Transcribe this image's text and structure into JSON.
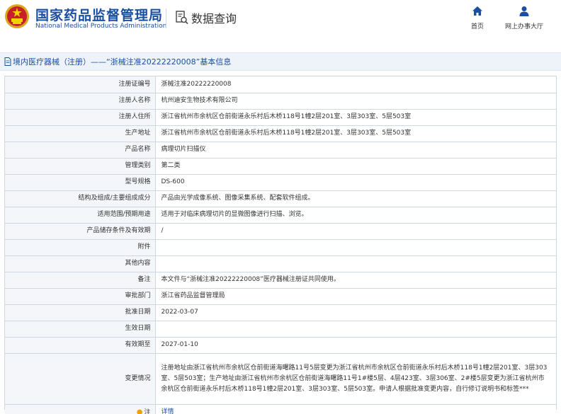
{
  "header": {
    "brand_cn": "国家药品监督管理局",
    "brand_en": "National Medical Products Administration",
    "query_label": "数据查询",
    "nav_home": "首页",
    "nav_service": "网上办事大厅"
  },
  "title": "境内医疗器械（注册）——“浙械注准20222220008”基本信息",
  "rows": [
    {
      "label": "注册证编号",
      "value": "浙械注准20222220008"
    },
    {
      "label": "注册人名称",
      "value": "杭州迪安生物技术有限公司"
    },
    {
      "label": "注册人住所",
      "value": "浙江省杭州市余杭区仓前街道永乐村后木桥118号1幢2层201室、3层303室、5层503室"
    },
    {
      "label": "生产地址",
      "value": "浙江省杭州市余杭区仓前街道永乐村后木桥118号1幢2层201室、3层303室、5层503室"
    },
    {
      "label": "产品名称",
      "value": "病理切片扫描仪"
    },
    {
      "label": "管理类别",
      "value": "第二类"
    },
    {
      "label": "型号规格",
      "value": "DS-600"
    },
    {
      "label": "结构及组成/主要组成成分",
      "value": "产品由光学成像系统、图像采集系统、配套软件组成。"
    },
    {
      "label": "适用范围/预期用途",
      "value": "适用于对临床病理切片的显微图像进行扫描、浏览。"
    },
    {
      "label": "产品储存条件及有效期",
      "value": "/"
    },
    {
      "label": "附件",
      "value": ""
    },
    {
      "label": "其他内容",
      "value": ""
    },
    {
      "label": "备注",
      "value": "本文件与“浙械注准20222220008”医疗器械注册证共同使用。"
    },
    {
      "label": "审批部门",
      "value": "浙江省药品监督管理局"
    },
    {
      "label": "批准日期",
      "value": "2022-03-07"
    },
    {
      "label": "生效日期",
      "value": ""
    },
    {
      "label": "有效期至",
      "value": "2027-01-10"
    },
    {
      "label": "变更情况",
      "value": "注册地址由浙江省杭州市余杭区仓前街道海曙路11号5层变更为浙江省杭州市余杭区仓前街道永乐村后木桥118号1幢2层201室、3层303室、5层503室；生产地址由浙江省杭州市余杭区仓前街道海曙路11号1#楼5层、4层423室、3层306室、2#楼5层变更为浙江省杭州市余杭区仓前街道永乐村后木桥118号1幢2层201室、3层303室、5层503室。申请人根据批准变更内容，自行修订说明书和标签***"
    }
  ],
  "note": {
    "label": "注",
    "link": "详情"
  },
  "colors": {
    "brand": "#1b4fa0",
    "label_bg": "#f4f6f9",
    "border": "#cfd7e2",
    "star": "#f0a000"
  },
  "icons": {
    "logo": "emblem-icon",
    "query": "search-document-icon",
    "home": "home-icon",
    "service": "user-icon",
    "title": "document-icon",
    "note": "star-icon"
  }
}
